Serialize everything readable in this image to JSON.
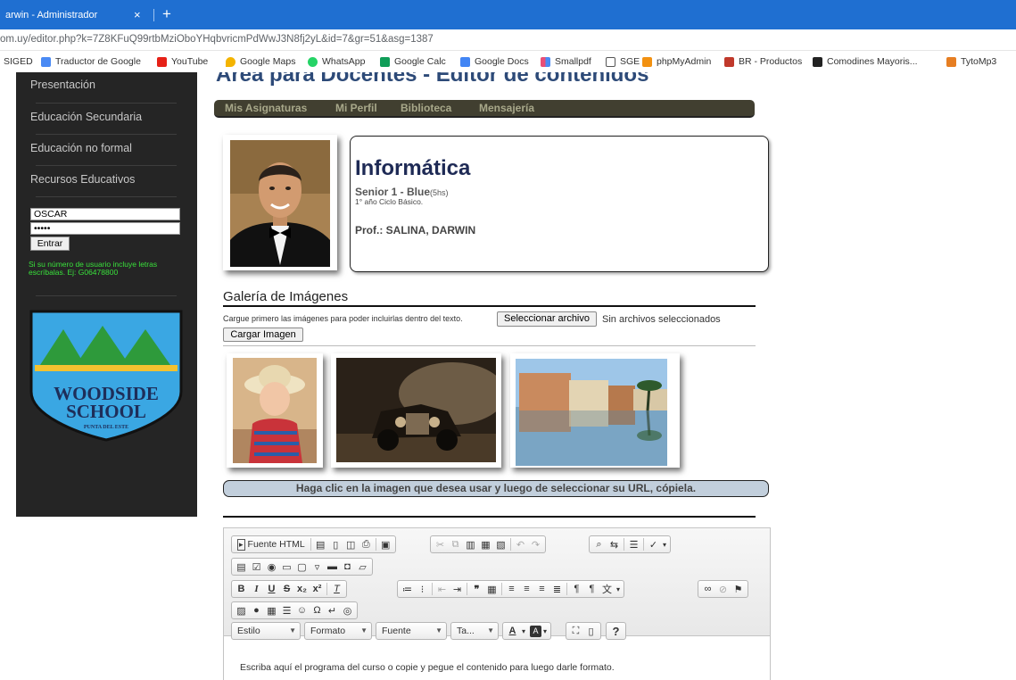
{
  "browser": {
    "tab_title": "arwin - Administrador",
    "tab_close": "×",
    "new_tab": "+",
    "url": "om.uy/editor.php?k=7Z8KFuQ99rtbMziOboYHqbvricmPdWwJ3N8fj2yL&id=7&gr=51&asg=1387",
    "bookmarks": [
      {
        "label": "SIGED",
        "color": "#ffffff"
      },
      {
        "label": "Traductor de Google",
        "color": "#4a8af4"
      },
      {
        "label": "YouTube",
        "color": "#e62117"
      },
      {
        "label": "Google Maps",
        "color": "#f4b400"
      },
      {
        "label": "WhatsApp",
        "color": "#25d366"
      },
      {
        "label": "Google Calc",
        "color": "#0f9d58"
      },
      {
        "label": "Google Docs",
        "color": "#4285f4"
      },
      {
        "label": "Smallpdf",
        "color": "#e94e77"
      },
      {
        "label": "SGE",
        "color": "#ffffff"
      },
      {
        "label": "phpMyAdmin",
        "color": "#f29111"
      },
      {
        "label": "BR - Productos",
        "color": "#c0392b"
      },
      {
        "label": "Comodines Mayoris...",
        "color": "#222222"
      },
      {
        "label": "TytoMp3",
        "color": "#e67e22"
      }
    ]
  },
  "sidebar": {
    "items": [
      "Presentación",
      "Educación Secundaria",
      "Educación no formal",
      "Recursos Educativos"
    ],
    "login": {
      "username": "OSCAR",
      "password": "•••••",
      "submit": "Entrar",
      "hint": "Si su número de usuario incluye letras escríbalas. Ej: G06478800"
    },
    "logo": {
      "line1": "WOODSIDE",
      "line2": "SCHOOL",
      "line3": "PUNTA DEL ESTE"
    }
  },
  "header": {
    "title": "Área para Docentes - Editor de contenidos",
    "nav": [
      "Mis Asignaturas",
      "Mi Perfil",
      "Biblioteca",
      "Mensajería"
    ]
  },
  "subject": {
    "name": "Informática",
    "group": "Senior 1 - Blue",
    "hours": "(5hs)",
    "year": "1° año Ciclo Básico.",
    "teacher": "Prof.: SALINA, DARWIN"
  },
  "gallery": {
    "title": "Galería de Imágenes",
    "instruction": "Cargue primero las imágenes para poder incluirlas dentro del texto.",
    "file_button": "Seleccionar archivo",
    "file_status": "Sin archivos seleccionados",
    "upload_button": "Cargar Imagen",
    "help": "Haga clic en la imagen que desea usar y luego de seleccionar su URL, cópiela."
  },
  "editor": {
    "source_label": "Fuente HTML",
    "combos": [
      "Estilo",
      "Formato",
      "Fuente",
      "Ta..."
    ],
    "placeholder_text": "Escriba aquí el programa del curso o copie y pegue el contenido para luego darle formato."
  }
}
